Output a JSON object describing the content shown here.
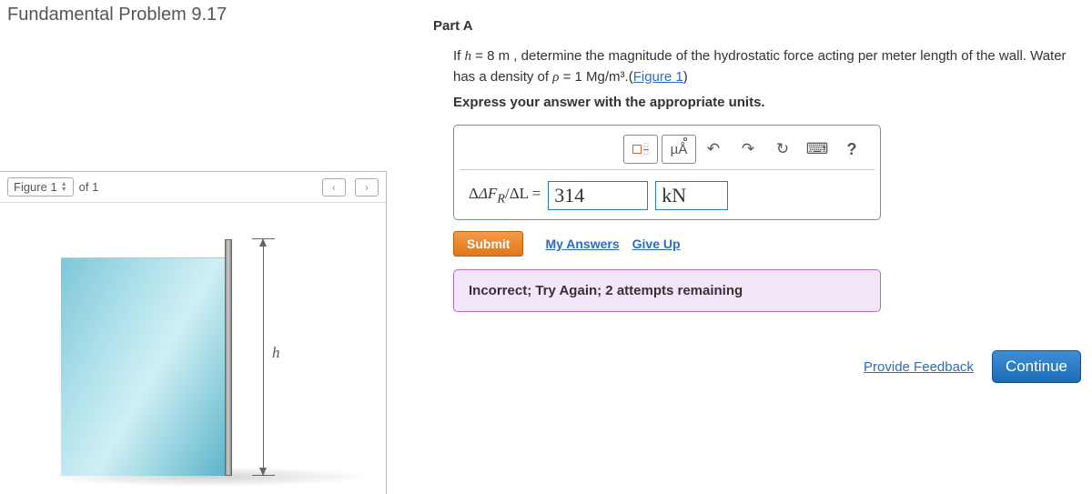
{
  "title": "Fundamental Problem 9.17",
  "figure": {
    "label": "Figure 1",
    "of_text": "of 1",
    "dim_label": "h"
  },
  "partA": {
    "heading": "Part A",
    "question_pre": "If ",
    "h_var": "h",
    "h_eq": " = 8 m ",
    "question_mid": ", determine the magnitude of the hydrostatic force acting per meter length of the wall. Water has a density of ",
    "rho_var": "ρ",
    "rho_eq": " = 1 Mg/m³",
    "period": ".(",
    "fig_link": "Figure 1",
    "close_paren": ")",
    "instruction": "Express your answer with the appropriate units.",
    "toolbar": {
      "mu_label": "µÅ",
      "help": "?"
    },
    "answer": {
      "label_html": "ΔF",
      "label_sub": "R",
      "label_mid": "/ΔL",
      "equals": " = ",
      "value": "314",
      "unit": "kN"
    },
    "submit": "Submit",
    "my_answers": "My Answers",
    "give_up": "Give Up",
    "feedback": "Incorrect; Try Again; 2 attempts remaining"
  },
  "footer": {
    "provide_feedback": "Provide Feedback",
    "continue": "Continue"
  }
}
